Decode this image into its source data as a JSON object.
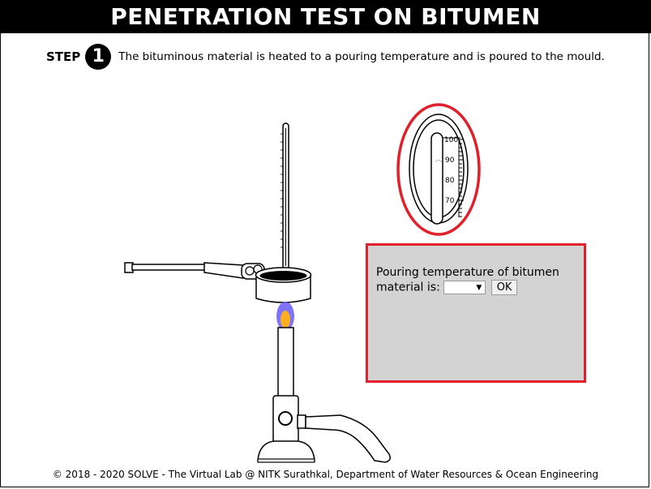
{
  "header": {
    "title": "PENETRATION TEST ON BITUMEN"
  },
  "step": {
    "label": "STEP",
    "number": "1",
    "instruction": "The bituminous material is heated to a pouring temperature and is poured to the mould."
  },
  "thermometer_zoom": {
    "scale_labels": [
      "100",
      "90",
      "80",
      "70"
    ],
    "highlight_color": "#e0202a"
  },
  "form": {
    "prompt": "Pouring temperature of bitumen material is:",
    "select_value": "",
    "ok_label": "OK"
  },
  "footer": {
    "text": "© 2018 - 2020 SOLVE - The Virtual Lab @ NITK Surathkal, Department of Water Resources & Ocean Engineering"
  },
  "colors": {
    "panel_bg": "#d3d3d3",
    "panel_border": "#e0202a",
    "flame_outer": "#6a5cff",
    "flame_inner": "#ffb020"
  },
  "icons": {
    "step_number": "circled-number-icon",
    "dropdown": "triangle-down-icon"
  }
}
